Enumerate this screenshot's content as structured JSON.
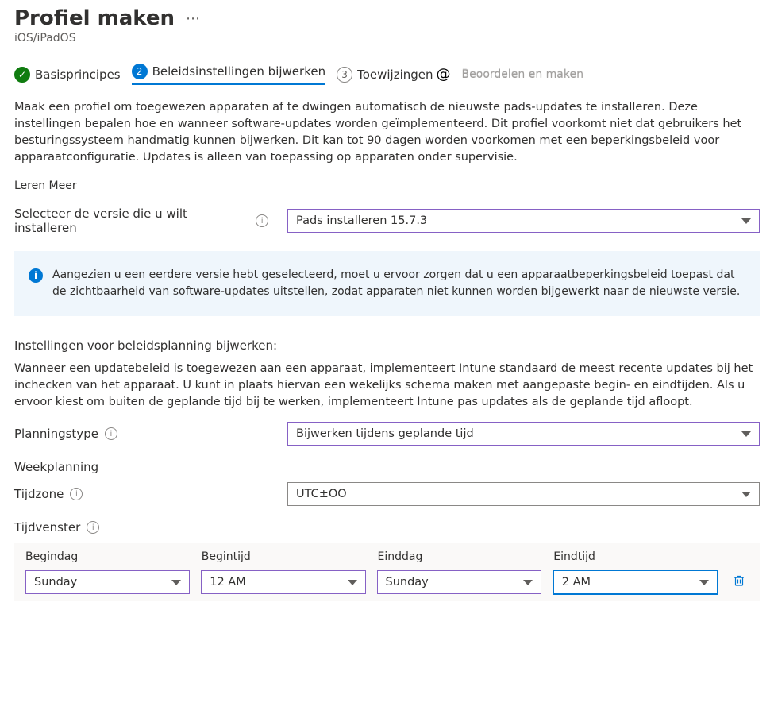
{
  "header": {
    "title": "Profiel maken",
    "subtitle": "iOS/iPadOS",
    "more": "⋯"
  },
  "steps": {
    "s1_label": "Basisprincipes",
    "s1_check": "✓",
    "s2_label": "Beleidsinstellingen bijwerken",
    "s2_num": "2",
    "s3_label": "Toewijzingen",
    "s3_num": "3",
    "s3_at": "@",
    "s4_label": "Beoordelen en maken"
  },
  "intro": {
    "paragraph": "Maak een profiel om toegewezen apparaten af te dwingen automatisch de nieuwste pads-updates te installeren. Deze instellingen bepalen hoe en wanneer software-updates worden geïmplementeerd. Dit profiel voorkomt niet dat gebruikers het besturingssysteem handmatig kunnen bijwerken. Dit kan tot 90 dagen worden voorkomen met een beperkingsbeleid voor apparaatconfiguratie. Updates is alleen van toepassing op apparaten onder supervisie.",
    "learn_more": "Leren  Meer"
  },
  "version": {
    "label": "Selecteer de versie die u wilt installeren",
    "value": "Pads installeren 15.7.3"
  },
  "info_box": {
    "text": "Aangezien u een eerdere versie hebt geselecteerd, moet u ervoor zorgen dat u een apparaatbeperkingsbeleid toepast dat de zichtbaarheid van software-updates uitstellen, zodat apparaten niet kunnen worden bijgewerkt naar de nieuwste versie."
  },
  "schedule": {
    "heading": "Instellingen voor beleidsplanning bijwerken:",
    "paragraph": "Wanneer een updatebeleid is toegewezen aan een apparaat, implementeert Intune standaard de meest recente updates bij het inchecken van het apparaat. U kunt in plaats hiervan een wekelijks schema maken met aangepaste begin- en eindtijden. Als u ervoor kiest om buiten de geplande tijd bij te werken, implementeert Intune pas updates als de geplande tijd afloopt.",
    "type_label": "Planningstype",
    "type_value": "Bijwerken tijdens geplande tijd",
    "weekly_label": "Weekplanning",
    "timezone_label": "Tijdzone",
    "timezone_value": "UTC±OO",
    "window_label": "Tijdvenster"
  },
  "table": {
    "h_startday": "Begindag",
    "h_starttime": "Begintijd",
    "h_endday": "Einddag",
    "h_endtime": "Eindtijd",
    "row": {
      "startday": "Sunday",
      "starttime": "12 AM",
      "endday": "Sunday",
      "endtime": "2 AM"
    }
  }
}
